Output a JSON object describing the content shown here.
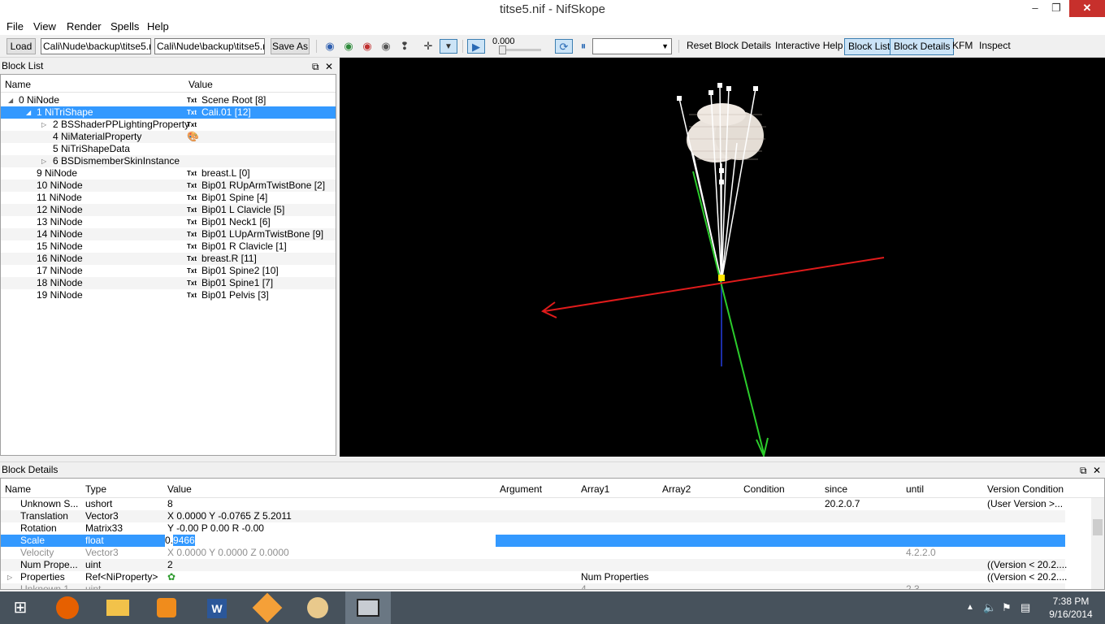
{
  "window": {
    "title": "titse5.nif - NifSkope",
    "minimize_glyph": "–",
    "maximize_glyph": "❐",
    "close_glyph": "✕"
  },
  "menu": [
    "File",
    "View",
    "Render",
    "Spells",
    "Help"
  ],
  "toolbar": {
    "load_label": "Load",
    "load_path": "Cali\\Nude\\backup\\titse5.nif",
    "save_path": "Cali\\Nude\\backup\\titse5.nif",
    "save_as_label": "Save As",
    "time_value": "0.000",
    "reset_label": "Reset Block Details",
    "help_label": "Interactive Help",
    "block_list_label": "Block List",
    "block_details_label": "Block Details",
    "kfm_label": "KFM",
    "inspect_label": "Inspect"
  },
  "block_list": {
    "title": "Block List",
    "columns": [
      "Name",
      "Value"
    ],
    "rows": [
      {
        "name": "0 NiNode",
        "icon": "Txt",
        "value": "Scene Root [8]"
      },
      {
        "name": "1 NiTriShape",
        "icon": "Txt",
        "value": "Cali.01 [12]"
      },
      {
        "name": "2 BSShaderPPLightingProperty",
        "icon": "Txt",
        "value": ""
      },
      {
        "name": "4 NiMaterialProperty",
        "icon": "🎨",
        "value": ""
      },
      {
        "name": "5 NiTriShapeData",
        "icon": "",
        "value": ""
      },
      {
        "name": "6 BSDismemberSkinInstance",
        "icon": "",
        "value": ""
      },
      {
        "name": "9 NiNode",
        "icon": "Txt",
        "value": "breast.L [0]"
      },
      {
        "name": "10 NiNode",
        "icon": "Txt",
        "value": "Bip01 RUpArmTwistBone [2]"
      },
      {
        "name": "11 NiNode",
        "icon": "Txt",
        "value": "Bip01 Spine [4]"
      },
      {
        "name": "12 NiNode",
        "icon": "Txt",
        "value": "Bip01 L Clavicle [5]"
      },
      {
        "name": "13 NiNode",
        "icon": "Txt",
        "value": "Bip01 Neck1 [6]"
      },
      {
        "name": "14 NiNode",
        "icon": "Txt",
        "value": "Bip01 LUpArmTwistBone [9]"
      },
      {
        "name": "15 NiNode",
        "icon": "Txt",
        "value": "Bip01 R Clavicle [1]"
      },
      {
        "name": "16 NiNode",
        "icon": "Txt",
        "value": "breast.R [11]"
      },
      {
        "name": "17 NiNode",
        "icon": "Txt",
        "value": "Bip01 Spine2 [10]"
      },
      {
        "name": "18 NiNode",
        "icon": "Txt",
        "value": "Bip01 Spine1 [7]"
      },
      {
        "name": "19 NiNode",
        "icon": "Txt",
        "value": "Bip01 Pelvis [3]"
      }
    ]
  },
  "block_details": {
    "title": "Block Details",
    "columns": [
      "Name",
      "Type",
      "Value",
      "Argument",
      "Array1",
      "Array2",
      "Condition",
      "since",
      "until",
      "Version Condition"
    ],
    "rows": [
      {
        "name": "Unknown S...",
        "type": "ushort",
        "value": "8",
        "argument": "",
        "array1": "",
        "array2": "",
        "condition": "",
        "since": "20.2.0.7",
        "until": "",
        "vercond": "(User Version >..."
      },
      {
        "name": "Translation",
        "type": "Vector3",
        "value": "X 0.0000 Y -0.0765 Z 5.2011",
        "argument": "",
        "array1": "",
        "array2": "",
        "condition": "",
        "since": "",
        "until": "",
        "vercond": ""
      },
      {
        "name": "Rotation",
        "type": "Matrix33",
        "value": "Y -0.00 P 0.00 R -0.00",
        "argument": "",
        "array1": "",
        "array2": "",
        "condition": "",
        "since": "",
        "until": "",
        "vercond": ""
      },
      {
        "name": "Scale",
        "type": "float",
        "value": "0.9466",
        "value_pre": "0.",
        "value_sel": "9466",
        "argument": "",
        "array1": "",
        "array2": "",
        "condition": "",
        "since": "",
        "until": "",
        "vercond": ""
      },
      {
        "name": "Velocity",
        "type": "Vector3",
        "value": "X 0.0000 Y 0.0000 Z 0.0000",
        "argument": "",
        "array1": "",
        "array2": "",
        "condition": "",
        "since": "",
        "until": "4.2.2.0",
        "vercond": ""
      },
      {
        "name": "Num Prope...",
        "type": "uint",
        "value": "2",
        "argument": "",
        "array1": "",
        "array2": "",
        "condition": "",
        "since": "",
        "until": "",
        "vercond": "((Version < 20.2...."
      },
      {
        "name": "Properties",
        "type": "Ref<NiProperty>",
        "value": "",
        "argument": "",
        "array1": "Num Properties",
        "array2": "",
        "condition": "",
        "since": "",
        "until": "",
        "vercond": "((Version < 20.2...."
      },
      {
        "name": "Unknown 1",
        "type": "uint",
        "value": "",
        "argument": "",
        "array1": "4",
        "array2": "",
        "condition": "",
        "since": "",
        "until": "2.3",
        "vercond": ""
      }
    ]
  },
  "taskbar": {
    "time": "7:38 PM",
    "date": "9/16/2014",
    "apps": [
      "windows-start",
      "firefox",
      "file-explorer",
      "media-player",
      "word",
      "blender",
      "fallout",
      "nifskope"
    ]
  },
  "colors": {
    "selection": "#3399ff",
    "taskbar": "#47525c",
    "viewport": "#000000"
  }
}
